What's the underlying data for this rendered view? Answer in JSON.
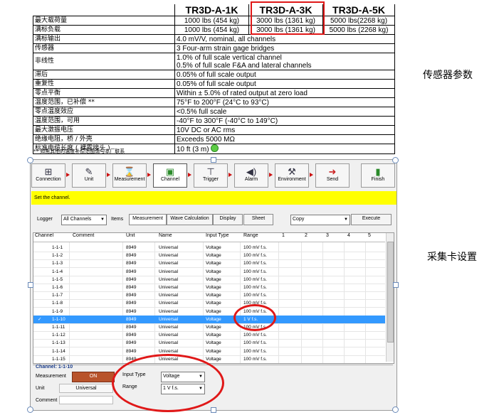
{
  "spec_table": {
    "columns": [
      "TR3D-A-1K",
      "TR3D-A-3K",
      "TR3D-A-5K"
    ],
    "rows": [
      {
        "label": "最大载荷量",
        "values": [
          "1000 lbs (454 kg)",
          "3000 lbs (1361 kg)",
          "5000 lbs(2268 kg)"
        ]
      },
      {
        "label": "满标负载",
        "values": [
          "1000 lbs (454 kg)",
          "3000 lbs (1361 kg)",
          "5000 lbs (2268 kg)"
        ]
      },
      {
        "label": "满标输出",
        "value": "4.0 mV/V, nominal, all channels"
      },
      {
        "label": "传感器",
        "value": "3 Four-arm strain gage bridges"
      },
      {
        "label": "非线性",
        "value_line1": "1.0% of full scale vertical channel",
        "value_line2": "0.5% of full scale F&A and lateral channels"
      },
      {
        "label": "滞后",
        "value": "0.05% of full scale output"
      },
      {
        "label": "重复性",
        "value": "0.05% of full scale output"
      },
      {
        "label": "零点平衡",
        "value": "Within ± 5.0% of rated output at zero load"
      },
      {
        "label": "温度范围，已补偿 **",
        "value": "75°F to 200°F (24°C to 93°C)"
      },
      {
        "label": "零点温度效应",
        "value": "<0.5% full scale"
      },
      {
        "label": "温度范围，可用",
        "value": "-40°F to 300°F (-40°C to 149°C)"
      },
      {
        "label": "最大激振电压",
        "value": "10V DC or AC rms"
      },
      {
        "label": "绝缘电阻，桥 / 外壳",
        "value": "Exceeds 5000 MΩ"
      },
      {
        "label": "标准电缆长度 ( 裸露接头 )",
        "value": "10 ft (3 m)"
      }
    ],
    "footnote": "** 如需其他的温度补偿范围请与本厂联系"
  },
  "side_labels": {
    "sensor_params": "传感器参数",
    "daq_settings": "采集卡设置"
  },
  "software": {
    "wizard_steps": [
      {
        "label": "Connection",
        "icon": "connection-icon"
      },
      {
        "label": "Unit",
        "icon": "unit-icon"
      },
      {
        "label": "Measurement",
        "icon": "hourglass-icon"
      },
      {
        "label": "Channel",
        "icon": "channel-icon"
      },
      {
        "label": "Trigger",
        "icon": "trigger-icon"
      },
      {
        "label": "Alarm",
        "icon": "alarm-icon"
      },
      {
        "label": "Environment",
        "icon": "environment-icon"
      },
      {
        "label": "Send",
        "icon": "send-icon"
      },
      {
        "label": "Finish",
        "icon": "finish-icon"
      }
    ],
    "active_step": "Channel",
    "banner": "Set the channel.",
    "logger_label": "Logger",
    "logger_value": "All Channels",
    "items_label": "Items",
    "item_tabs": [
      "Measurement",
      "Wave Calculation",
      "Display",
      "Sheet"
    ],
    "copy_value": "Copy",
    "execute_label": "Execute",
    "grid_headers": [
      "Channel",
      "Comment",
      "Unit",
      "Name",
      "Input Type",
      "Range",
      "1",
      "2",
      "3",
      "4",
      "5"
    ],
    "grid_rows": [
      {
        "channel": "1-1-1",
        "unit": "8949",
        "name": "Universal",
        "input_type": "Voltage",
        "range": "100 mV f.s."
      },
      {
        "channel": "1-1-2",
        "unit": "8949",
        "name": "Universal",
        "input_type": "Voltage",
        "range": "100 mV f.s."
      },
      {
        "channel": "1-1-3",
        "unit": "8949",
        "name": "Universal",
        "input_type": "Voltage",
        "range": "100 mV f.s."
      },
      {
        "channel": "1-1-4",
        "unit": "8949",
        "name": "Universal",
        "input_type": "Voltage",
        "range": "100 mV f.s."
      },
      {
        "channel": "1-1-5",
        "unit": "8949",
        "name": "Universal",
        "input_type": "Voltage",
        "range": "100 mV f.s."
      },
      {
        "channel": "1-1-6",
        "unit": "8949",
        "name": "Universal",
        "input_type": "Voltage",
        "range": "100 mV f.s."
      },
      {
        "channel": "1-1-7",
        "unit": "8949",
        "name": "Universal",
        "input_type": "Voltage",
        "range": "100 mV f.s."
      },
      {
        "channel": "1-1-8",
        "unit": "8949",
        "name": "Universal",
        "input_type": "Voltage",
        "range": "100 mV f.s."
      },
      {
        "channel": "1-1-9",
        "unit": "8949",
        "name": "Universal",
        "input_type": "Voltage",
        "range": "100 mV f.s."
      },
      {
        "channel": "1-1-10",
        "unit": "8949",
        "name": "Universal",
        "input_type": "Voltage",
        "range": "1 V f.s.",
        "selected": true
      },
      {
        "channel": "1-1-11",
        "unit": "8949",
        "name": "Universal",
        "input_type": "Voltage",
        "range": "100 mV f.s."
      },
      {
        "channel": "1-1-12",
        "unit": "8949",
        "name": "Universal",
        "input_type": "Voltage",
        "range": "100 mV f.s."
      },
      {
        "channel": "1-1-13",
        "unit": "8949",
        "name": "Universal",
        "input_type": "Voltage",
        "range": "100 mV f.s."
      },
      {
        "channel": "1-1-14",
        "unit": "8949",
        "name": "Universal",
        "input_type": "Voltage",
        "range": "100 mV f.s."
      },
      {
        "channel": "1-1-15",
        "unit": "8949",
        "name": "Universal",
        "input_type": "Voltage",
        "range": "100 mV f.s."
      }
    ],
    "detail": {
      "title": "Channel: 1-1-10",
      "measurement_label": "Measurement",
      "measurement_value": "ON",
      "unit_label": "Unit",
      "unit_value": "Universal",
      "comment_label": "Comment",
      "input_type_label": "Input Type",
      "input_type_value": "Voltage",
      "range_label": "Range",
      "range_value": "1 V f.s."
    }
  },
  "colors": {
    "highlight": "#e01818",
    "banner": "#ffff00",
    "selection": "#3399ff",
    "on_button": "#b8532b"
  }
}
